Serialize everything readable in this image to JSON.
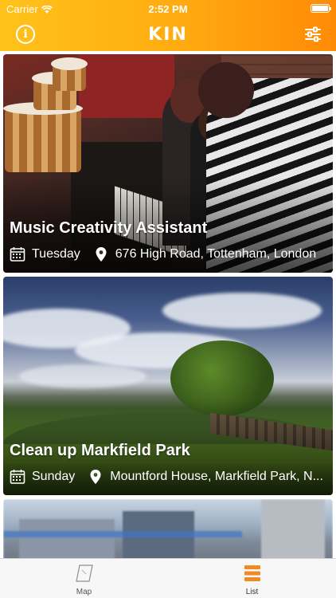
{
  "status_bar": {
    "carrier": "Carrier",
    "time": "2:52 PM"
  },
  "nav": {
    "logo": "KIN",
    "info_icon": "info-circle-icon",
    "filter_icon": "sliders-icon",
    "accent_start": "#ffc21a",
    "accent_end": "#ff8a06"
  },
  "events": [
    {
      "title": "Music Creativity Assistant",
      "day": "Tuesday",
      "location": "676 High Road, Tottenham, London"
    },
    {
      "title": "Clean up Markfield Park",
      "day": "Sunday",
      "location": "Mountford House, Markfield Park, N..."
    }
  ],
  "tabs": [
    {
      "label": "Map",
      "icon": "map-icon",
      "selected": false
    },
    {
      "label": "List",
      "icon": "list-icon",
      "selected": true,
      "color": "#f08a24"
    }
  ]
}
